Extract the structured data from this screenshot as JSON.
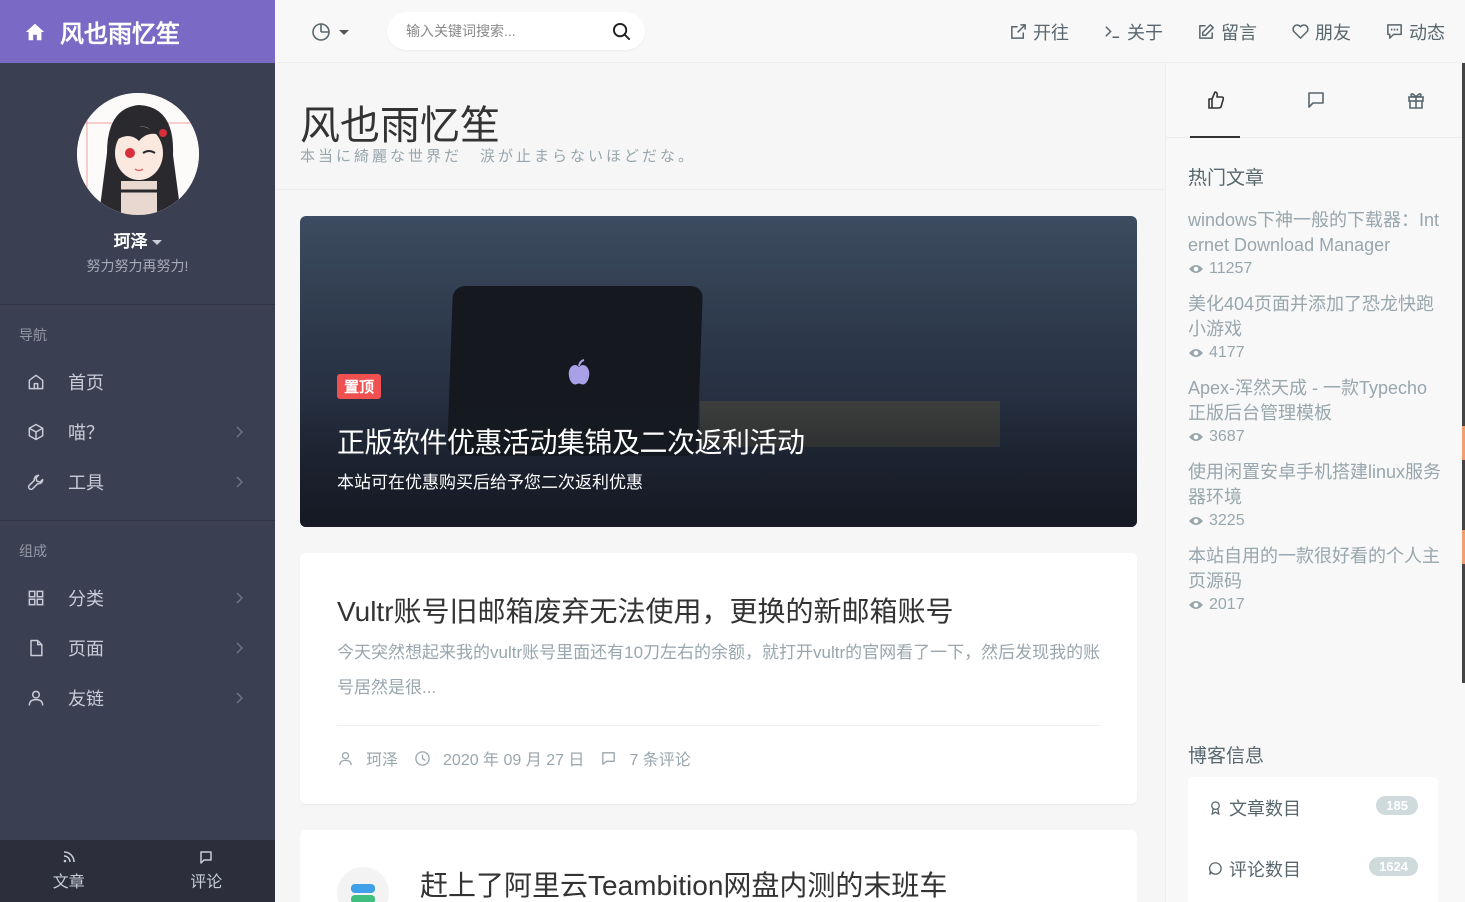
{
  "brand": {
    "title": "风也雨忆笙",
    "icon": "home-icon"
  },
  "profile": {
    "name": "珂泽",
    "motto": "努力努力再努力!"
  },
  "sidebar": {
    "nav_heading": "导航",
    "nav_items": [
      {
        "label": "首页",
        "icon": "home-outline-icon",
        "has_children": false
      },
      {
        "label": "喵？",
        "icon": "cube-icon",
        "has_children": true
      },
      {
        "label": "工具",
        "icon": "wrench-icon",
        "has_children": true
      }
    ],
    "group_heading": "组成",
    "group_items": [
      {
        "label": "分类",
        "icon": "grid-icon",
        "has_children": true
      },
      {
        "label": "页面",
        "icon": "file-icon",
        "has_children": true
      },
      {
        "label": "友链",
        "icon": "user-icon",
        "has_children": true
      }
    ],
    "footer": [
      {
        "label": "文章",
        "icon": "rss-icon"
      },
      {
        "label": "评论",
        "icon": "comment-icon"
      }
    ]
  },
  "topbar": {
    "search": {
      "placeholder": "输入关键词搜索..."
    },
    "nav": [
      {
        "label": "开往",
        "icon": "external-link-icon"
      },
      {
        "label": "关于",
        "icon": "terminal-icon"
      },
      {
        "label": "留言",
        "icon": "edit-icon"
      },
      {
        "label": "朋友",
        "icon": "heart-icon"
      },
      {
        "label": "动态",
        "icon": "chat-icon"
      }
    ]
  },
  "header": {
    "title": "风也雨忆笙",
    "subtitle": "本当に綺麗な世界だ　涙が止まらないほどだな。"
  },
  "featured": {
    "badge": "置顶",
    "title": "正版软件优惠活动集锦及二次返利活动",
    "description": "本站可在优惠购买后给予您二次返利优惠"
  },
  "posts": [
    {
      "title": "Vultr账号旧邮箱废弃无法使用，更换的新邮箱账号",
      "excerpt": "今天突然想起来我的vultr账号里面还有10刀左右的余额，就打开vultr的官网看了一下，然后发现我的账号居然是很...",
      "author": "珂泽",
      "date": "2020 年 09 月 27 日",
      "comments": "7 条评论"
    },
    {
      "title": "赶上了阿里云Teambition网盘内测的末班车"
    }
  ],
  "right": {
    "tabs": [
      {
        "icon": "thumbs-up-icon",
        "active": true
      },
      {
        "icon": "comment-icon",
        "active": false
      },
      {
        "icon": "gift-icon",
        "active": false
      }
    ],
    "hot_heading": "热门文章",
    "hot": [
      {
        "title": "windows下神一般的下载器：Internet Download Manager",
        "views": "11257"
      },
      {
        "title": "美化404页面并添加了恐龙快跑小游戏",
        "views": "4177"
      },
      {
        "title": "Apex-浑然天成 - 一款Typecho正版后台管理模板",
        "views": "3687"
      },
      {
        "title": "使用闲置安卓手机搭建linux服务器环境",
        "views": "3225"
      },
      {
        "title": "本站自用的一款很好看的个人主页源码",
        "views": "2017"
      }
    ],
    "info_heading": "博客信息",
    "info": [
      {
        "label": "文章数目",
        "value": "185",
        "icon": "award-icon"
      },
      {
        "label": "评论数目",
        "value": "1624",
        "icon": "message-circle-icon"
      }
    ]
  },
  "colors": {
    "brand": "#7a6ac5",
    "sidebar": "#3a3f51",
    "badge": "#f05050"
  }
}
